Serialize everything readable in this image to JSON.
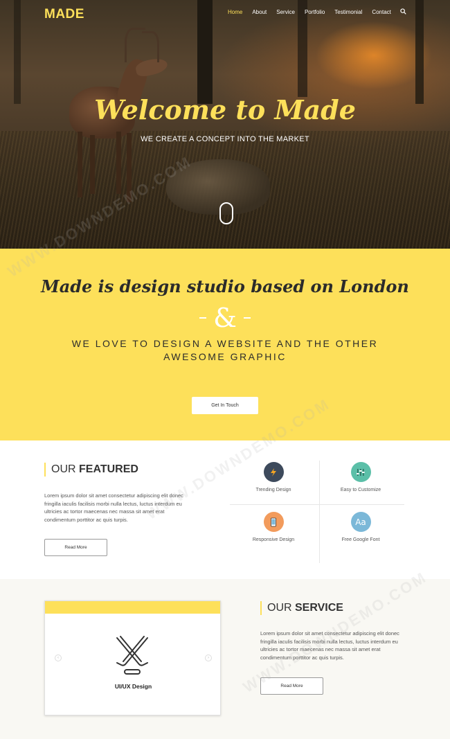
{
  "nav": {
    "logo": "MADE",
    "items": [
      "Home",
      "About",
      "Service",
      "Portfolio",
      "Testimonial",
      "Contact"
    ],
    "active": "Home",
    "search_icon": "search-icon"
  },
  "hero": {
    "title": "Welcome to Made",
    "subtitle": "WE CREATE A CONCEPT INTO THE MARKET"
  },
  "about": {
    "headline": "Made is design studio based on London",
    "ampersand": "&",
    "tagline_line1": "WE LOVE TO DESIGN A WEBSITE AND THE OTHER",
    "tagline_line2": "AWESOME GRAPHIC",
    "button": "Get In Touch"
  },
  "featured": {
    "title_light": "OUR ",
    "title_bold": "FEATURED",
    "body": "Lorem ipsum dolor sit amet consectetur adipiscing elit donec fringilla iaculis facilisis morbi nulla lectus, luctus interdum eu ultricies ac tortor maecenas nec massa sit amet erat condimentum porttitor ac quis turpis.",
    "button": "Read More",
    "items": [
      {
        "label": "Trending Design",
        "icon": "lightning-icon",
        "color": "#3d4a5c"
      },
      {
        "label": "Easy to Customize",
        "icon": "sliders-icon",
        "color": "#5bbfa8"
      },
      {
        "label": "Responsive Design",
        "icon": "phone-icon",
        "color": "#f29b5c"
      },
      {
        "label": "Free Google Font",
        "icon": "font-icon",
        "color": "#7bb8d8"
      }
    ]
  },
  "service": {
    "title_light": "OUR ",
    "title_bold": "SERVICE",
    "body": "Lorem ipsum dolor sit amet consectetur adipiscing elit donec fringilla iaculis facilisis morbi nulla lectus, luctus interdum eu ultricies ac tortor maecenas nec massa sit amet erat condimentum porttitor ac quis turpis.",
    "button": "Read More",
    "card_title": "UI/UX Design",
    "card_icon": "hockey-sticks-icon"
  },
  "colors": {
    "accent": "#fde05a"
  },
  "watermark": "WWW.DOWNDEMO.COM"
}
